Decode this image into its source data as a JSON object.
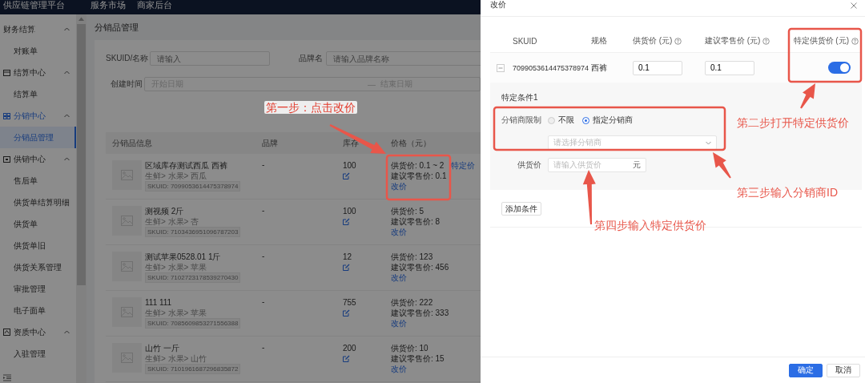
{
  "top_bar": {
    "title": "供应链管理平台",
    "nav": [
      "服务市场",
      "商家后台"
    ]
  },
  "sidebar": {
    "groups": [
      {
        "label": "财务结算",
        "expanded": true,
        "active": false,
        "items": [
          {
            "label": "对账单",
            "selected": false
          }
        ]
      },
      {
        "label": "结算中心",
        "expanded": true,
        "active": false,
        "items": [
          {
            "label": "结算单",
            "selected": false
          }
        ]
      },
      {
        "label": "分销中心",
        "expanded": true,
        "active": true,
        "items": [
          {
            "label": "分销品管理",
            "selected": true
          }
        ]
      },
      {
        "label": "供销中心",
        "expanded": true,
        "active": false,
        "items": [
          {
            "label": "售后单",
            "selected": false
          },
          {
            "label": "供货单结算明细",
            "selected": false
          },
          {
            "label": "供货单",
            "selected": false
          },
          {
            "label": "供货单旧",
            "selected": false
          },
          {
            "label": "供货关系管理",
            "selected": false
          },
          {
            "label": "审批管理",
            "selected": false
          },
          {
            "label": "电子面单",
            "selected": false
          }
        ]
      },
      {
        "label": "资质中心",
        "expanded": true,
        "active": false,
        "items": [
          {
            "label": "入驻管理",
            "selected": false
          }
        ]
      }
    ]
  },
  "page": {
    "title": "分销品管理",
    "filters": [
      {
        "label": "SKUID/名称",
        "placeholder": "请输入"
      },
      {
        "label": "品牌名",
        "placeholder": "请输入品牌名称"
      }
    ],
    "date_filter": {
      "label": "创建时间",
      "start_placeholder": "开始日期",
      "separator": "—",
      "end_placeholder": "结束日期"
    },
    "table": {
      "columns": [
        "分销品信息",
        "品牌",
        "库存",
        "价格（元）"
      ],
      "rows": [
        {
          "name": "区域库存测试西瓜 西裤",
          "category": "生鲜> 水果> 西瓜",
          "skuid": "SKUID: 7099053614475378974",
          "brand": "-",
          "stock": "100",
          "supply_price": "供货价: 0.1 ~ 2",
          "retail_price": "建议零售价: 0.1",
          "action": "改价",
          "special_link": "特定价"
        },
        {
          "name": "测视频 2斤",
          "category": "生鲜> 水果> 杏",
          "skuid": "SKUID: 7103436951096787203",
          "brand": "-",
          "stock": "100",
          "supply_price": "供货价: 5",
          "retail_price": "建议零售价: 8",
          "action": "改价"
        },
        {
          "name": "测试苹果0528.01 1斤",
          "category": "生鲜> 水果> 苹果",
          "skuid": "SKUID: 7102723178539270430",
          "brand": "-",
          "stock": "12",
          "supply_price": "供货价: 123",
          "retail_price": "建议零售价: 456",
          "action": "改价"
        },
        {
          "name": "111 111",
          "category": "生鲜> 水果> 苹果",
          "skuid": "SKUID: 7085609853271556388",
          "brand": "-",
          "stock": "755",
          "supply_price": "供货价: 222",
          "retail_price": "建议零售价: 333",
          "action": "改价"
        },
        {
          "name": "山竹 一斤",
          "category": "生鲜> 水果> 山竹",
          "skuid": "SKUID: 7101961687296835872",
          "brand": "-",
          "stock": "200",
          "supply_price": "供货价: 10",
          "retail_price": "建议零售价: 15",
          "action": "改价"
        }
      ]
    }
  },
  "drawer": {
    "title": "改价",
    "columns": [
      {
        "label": "SKUID",
        "help": false
      },
      {
        "label": "规格",
        "help": false
      },
      {
        "label": "供货价 (元)",
        "help": true
      },
      {
        "label": "建议零售价 (元)",
        "help": true
      },
      {
        "label": "特定供货价 (元)",
        "help": true
      }
    ],
    "row": {
      "expanded": true,
      "skuid": "7099053614475378974",
      "spec": "西裤",
      "supply_price": "0.1",
      "retail_price": "0.1",
      "special_price_on": true
    },
    "condition": {
      "title": "特定条件1",
      "limit_label": "分销商限制",
      "options": [
        {
          "label": "不限",
          "selected": false
        },
        {
          "label": "指定分销商",
          "selected": true
        }
      ],
      "select_placeholder": "请选择分销商",
      "price_label": "供货价",
      "price_placeholder": "请输入供货价",
      "price_suffix": "元"
    },
    "add_button": "添加条件",
    "buttons": [
      {
        "label": "确定",
        "kind": "primary"
      },
      {
        "label": "取消",
        "kind": "default"
      }
    ]
  },
  "annotations": [
    {
      "text": "第一步：点击改价"
    },
    {
      "text": "第二步打开特定供货价"
    },
    {
      "text": "第三步输入分销商ID"
    },
    {
      "text": "第四步输入特定供货价"
    }
  ]
}
